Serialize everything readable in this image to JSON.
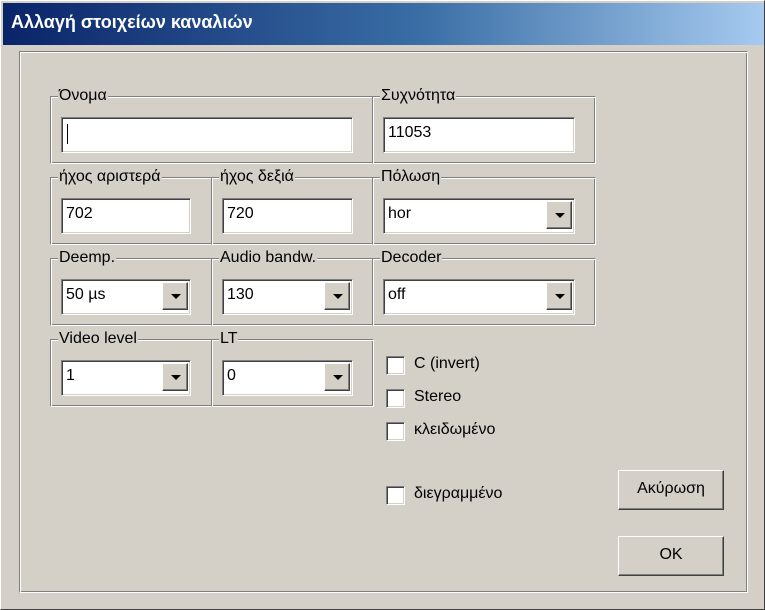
{
  "window": {
    "title": "Αλλαγή στοιχείων καναλιών"
  },
  "fields": {
    "name": {
      "label": "Όνομα",
      "value": ""
    },
    "frequency": {
      "label": "Συχνότητα",
      "value": "11053"
    },
    "audio_left": {
      "label": "ήχος αριστερά",
      "value": "702"
    },
    "audio_right": {
      "label": "ήχος δεξιά",
      "value": "720"
    },
    "polarization": {
      "label": "Πόλωση",
      "value": "hor"
    },
    "deemphasis": {
      "label": "Deemp.",
      "value": "50 µs"
    },
    "audio_bandwidth": {
      "label": "Audio bandw.",
      "value": "130"
    },
    "decoder": {
      "label": "Decoder",
      "value": "off"
    },
    "video_level": {
      "label": "Video level",
      "value": "1"
    },
    "lt": {
      "label": "LT",
      "value": "0"
    }
  },
  "checkboxes": {
    "c_invert": {
      "label": "C (invert)",
      "checked": false
    },
    "stereo": {
      "label": "Stereo",
      "checked": false
    },
    "locked": {
      "label": "κλειδωμένο",
      "checked": false
    },
    "deleted": {
      "label": "διεγραμμένο",
      "checked": false
    }
  },
  "buttons": {
    "cancel": "Ακύρωση",
    "ok": "OK"
  },
  "colors": {
    "face": "#d4d0c8",
    "title_start": "#0a246a",
    "title_end": "#a6caf0",
    "title_text": "#ffffff"
  }
}
